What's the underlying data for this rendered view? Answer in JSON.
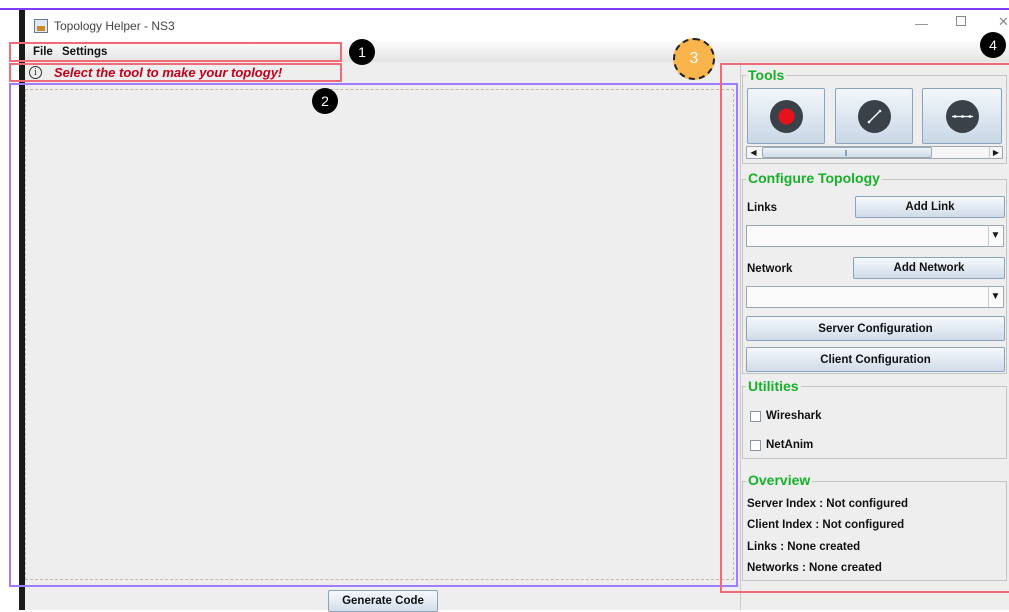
{
  "window": {
    "title": "Topology Helper - NS3"
  },
  "menu": {
    "items": [
      "File",
      "Settings"
    ]
  },
  "instruction": "Select the tool to make your toplogy!",
  "canvas": {
    "generate_button": "Generate Code"
  },
  "tools": {
    "title": "Tools",
    "buttons": [
      {
        "icon": "node-icon",
        "color": "#e8121d"
      },
      {
        "icon": "link-icon"
      },
      {
        "icon": "network-icon"
      }
    ]
  },
  "configure": {
    "title": "Configure Topology",
    "links_label": "Links",
    "add_link": "Add Link",
    "network_label": "Network",
    "add_network": "Add Network",
    "server_config": "Server Configuration",
    "client_config": "Client Configuration"
  },
  "utilities": {
    "title": "Utilities",
    "wireshark": "Wireshark",
    "netanim": "NetAnim"
  },
  "overview": {
    "title": "Overview",
    "server_index": "Server Index :  Not configured",
    "client_index": "Client Index  : Not configured",
    "links": "Links :  None created",
    "networks": "Networks : None created"
  },
  "annotations": {
    "labels": [
      "1",
      "2",
      "3",
      "4"
    ]
  }
}
